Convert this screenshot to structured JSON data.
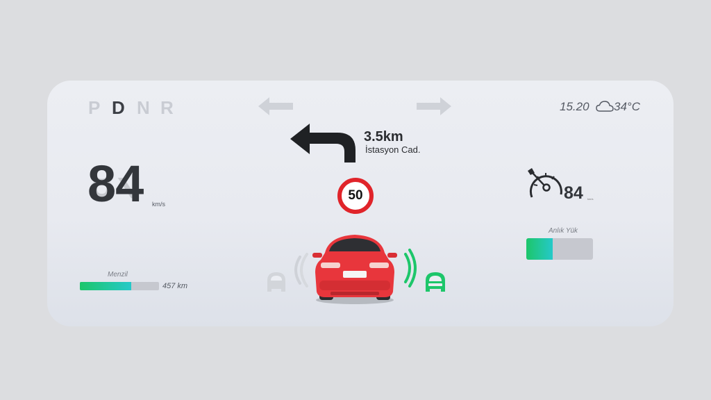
{
  "gears": {
    "items": [
      "P",
      "D",
      "N",
      "R"
    ],
    "selected": "D"
  },
  "status": {
    "time": "15.20",
    "weather_icon": "cloud-icon",
    "temperature": "34°C"
  },
  "navigation": {
    "icon": "turn-left-arrow-icon",
    "distance": "3.5km",
    "street": "İstasyon Cad."
  },
  "speed": {
    "value": "84",
    "unit": "km/s"
  },
  "speed_limit": {
    "value": "50",
    "color": "#e0242a"
  },
  "cruise": {
    "icon": "speedometer-icon",
    "value": "84",
    "unit": "km/s"
  },
  "load": {
    "label": "Anlık Yük",
    "level_percent": 40
  },
  "range": {
    "label": "Menzil",
    "value": "457 km",
    "level_percent": 65
  },
  "colors": {
    "accent_green": "#1dc66a",
    "accent_cyan": "#25c9c9",
    "car_red": "#e8363c",
    "limit_red": "#e0242a"
  }
}
